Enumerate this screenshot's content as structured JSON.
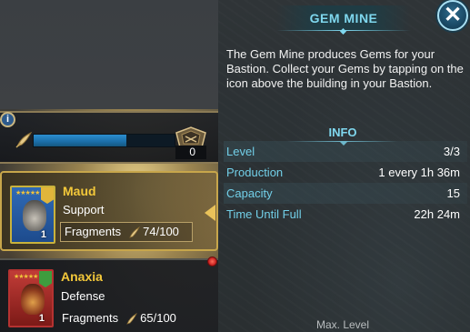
{
  "resource": {
    "progress": 0.66,
    "count": "0"
  },
  "info_badge": "i",
  "champions": [
    {
      "name": "Maud",
      "role": "Support",
      "fragments_label": "Fragments",
      "fragments_value": "74/100",
      "level": "1",
      "stars": "★★★★★"
    },
    {
      "name": "Anaxia",
      "role": "Defense",
      "fragments_label": "Fragments",
      "fragments_value": "65/100",
      "level": "1",
      "stars": "★★★★★"
    }
  ],
  "panel": {
    "title": "GEM MINE",
    "close_glyph": "✕",
    "description": "The Gem Mine produces Gems for your Bastion. Collect your Gems by tapping on the icon above the building in your Bastion.",
    "info_header": "INFO",
    "stats": [
      {
        "label": "Level",
        "value": "3/3"
      },
      {
        "label": "Production",
        "value": "1 every 1h 36m"
      },
      {
        "label": "Capacity",
        "value": "15"
      },
      {
        "label": "Time Until Full",
        "value": "22h 24m"
      }
    ],
    "footer": "Max. Level"
  },
  "colors": {
    "accent": "#7fd7ee",
    "champion_name": "#f3c83a",
    "progress_fill": "#2c8ed0"
  }
}
